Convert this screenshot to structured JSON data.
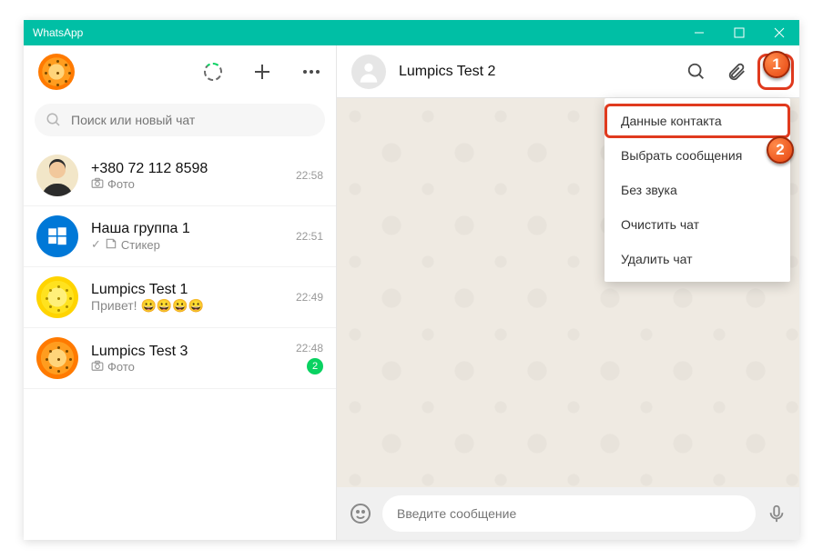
{
  "app_title": "WhatsApp",
  "search_placeholder": "Поиск или новый чат",
  "chats": [
    {
      "title": "+380 72 112 8598",
      "sub_icon": "camera",
      "sub_text": "Фото",
      "time": "22:58",
      "unread": null
    },
    {
      "title": "Наша группа 1",
      "sub_icon": "tick",
      "sub_text": "Стикер",
      "sticker": true,
      "time": "22:51",
      "unread": null
    },
    {
      "title": "Lumpics Test 1",
      "sub_text": "Привет! 😀😀😀😀",
      "time": "22:49",
      "unread": null
    },
    {
      "title": "Lumpics Test 3",
      "sub_icon": "camera",
      "sub_text": "Фото",
      "time": "22:48",
      "unread": "2"
    }
  ],
  "active_chat": {
    "name": "Lumpics Test 2"
  },
  "composer_placeholder": "Введите сообщение",
  "menu": {
    "contact_info": "Данные контакта",
    "select_messages": "Выбрать сообщения",
    "mute": "Без звука",
    "clear_chat": "Очистить чат",
    "delete_chat": "Удалить чат"
  },
  "markers": {
    "one": "1",
    "two": "2"
  }
}
